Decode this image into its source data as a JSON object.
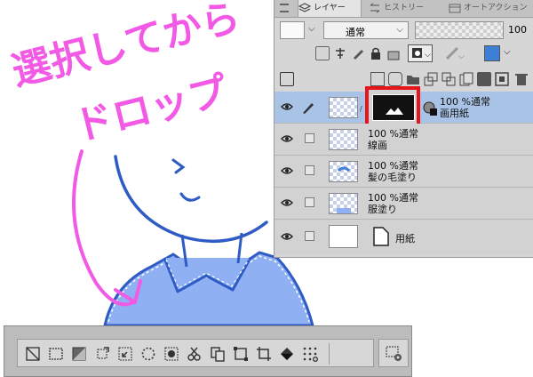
{
  "annotation": {
    "line1": "選択してから",
    "line2": "ドロップ"
  },
  "layer_panel": {
    "tabs": [
      {
        "label": "レイヤー",
        "icon": "layers-icon"
      },
      {
        "label": "ヒストリー",
        "icon": "history-icon"
      },
      {
        "label": "オートアクション",
        "icon": "auto-action-icon"
      }
    ],
    "blend_mode": "通常",
    "opacity": "100",
    "layers": [
      {
        "opacity_mode": "100 %通常",
        "name": "画用紙",
        "selected": true
      },
      {
        "opacity_mode": "100 %通常",
        "name": "線画",
        "selected": false
      },
      {
        "opacity_mode": "100 %通常",
        "name": "髪の毛塗り",
        "selected": false
      },
      {
        "opacity_mode": "100 %通常",
        "name": "服塗り",
        "selected": false
      },
      {
        "opacity_mode": "",
        "name": "用紙",
        "selected": false
      }
    ]
  },
  "colors": {
    "accent_blue": "#3d7fd6",
    "highlight_red": "#e8141c",
    "annotation_pink": "#f25ae6",
    "line_blue": "#2f5bc4",
    "shirt_fill": "#8fb0f2"
  }
}
